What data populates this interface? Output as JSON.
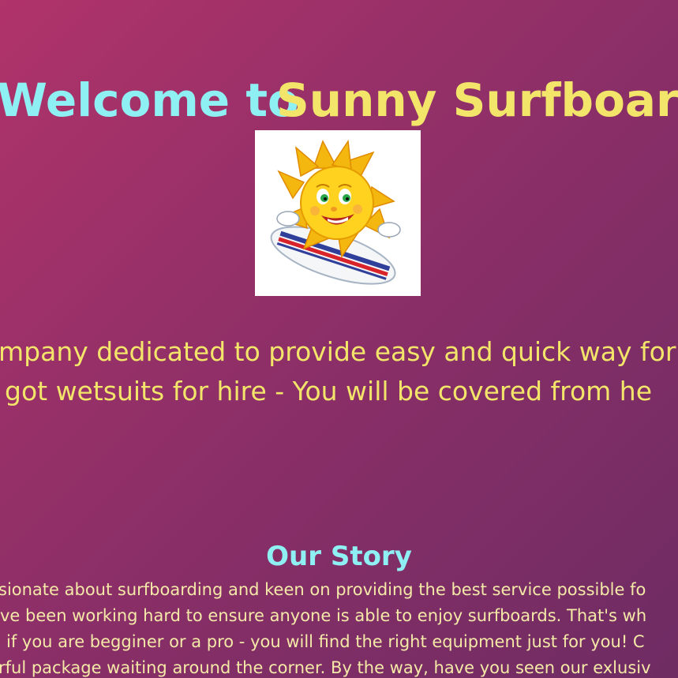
{
  "header": {
    "welcome": "Welcome to",
    "brand": "Sunny Surfboards"
  },
  "logo": {
    "icon": "sun-surfing-mascot"
  },
  "intro": {
    "line1": "mpany dedicated to provide easy and quick way for l",
    "line2": "got wetsuits for hire - You will be covered from he"
  },
  "story": {
    "title": "Our Story",
    "lines": [
      "sionate about surfboarding and keen on providing the best service possible fo",
      "ve been working hard to ensure anyone is able to enjoy surfboards. That's wh",
      "if you are begginer or a pro - you will find the right equipment just for you! C",
      "rful package waiting around the corner. By the way, have you seen our exlusiv"
    ]
  },
  "colors": {
    "background_start": "#b0336a",
    "background_end": "#6e2c63",
    "accent_cyan": "#8ff0f4",
    "accent_yellow": "#f2e56a"
  }
}
